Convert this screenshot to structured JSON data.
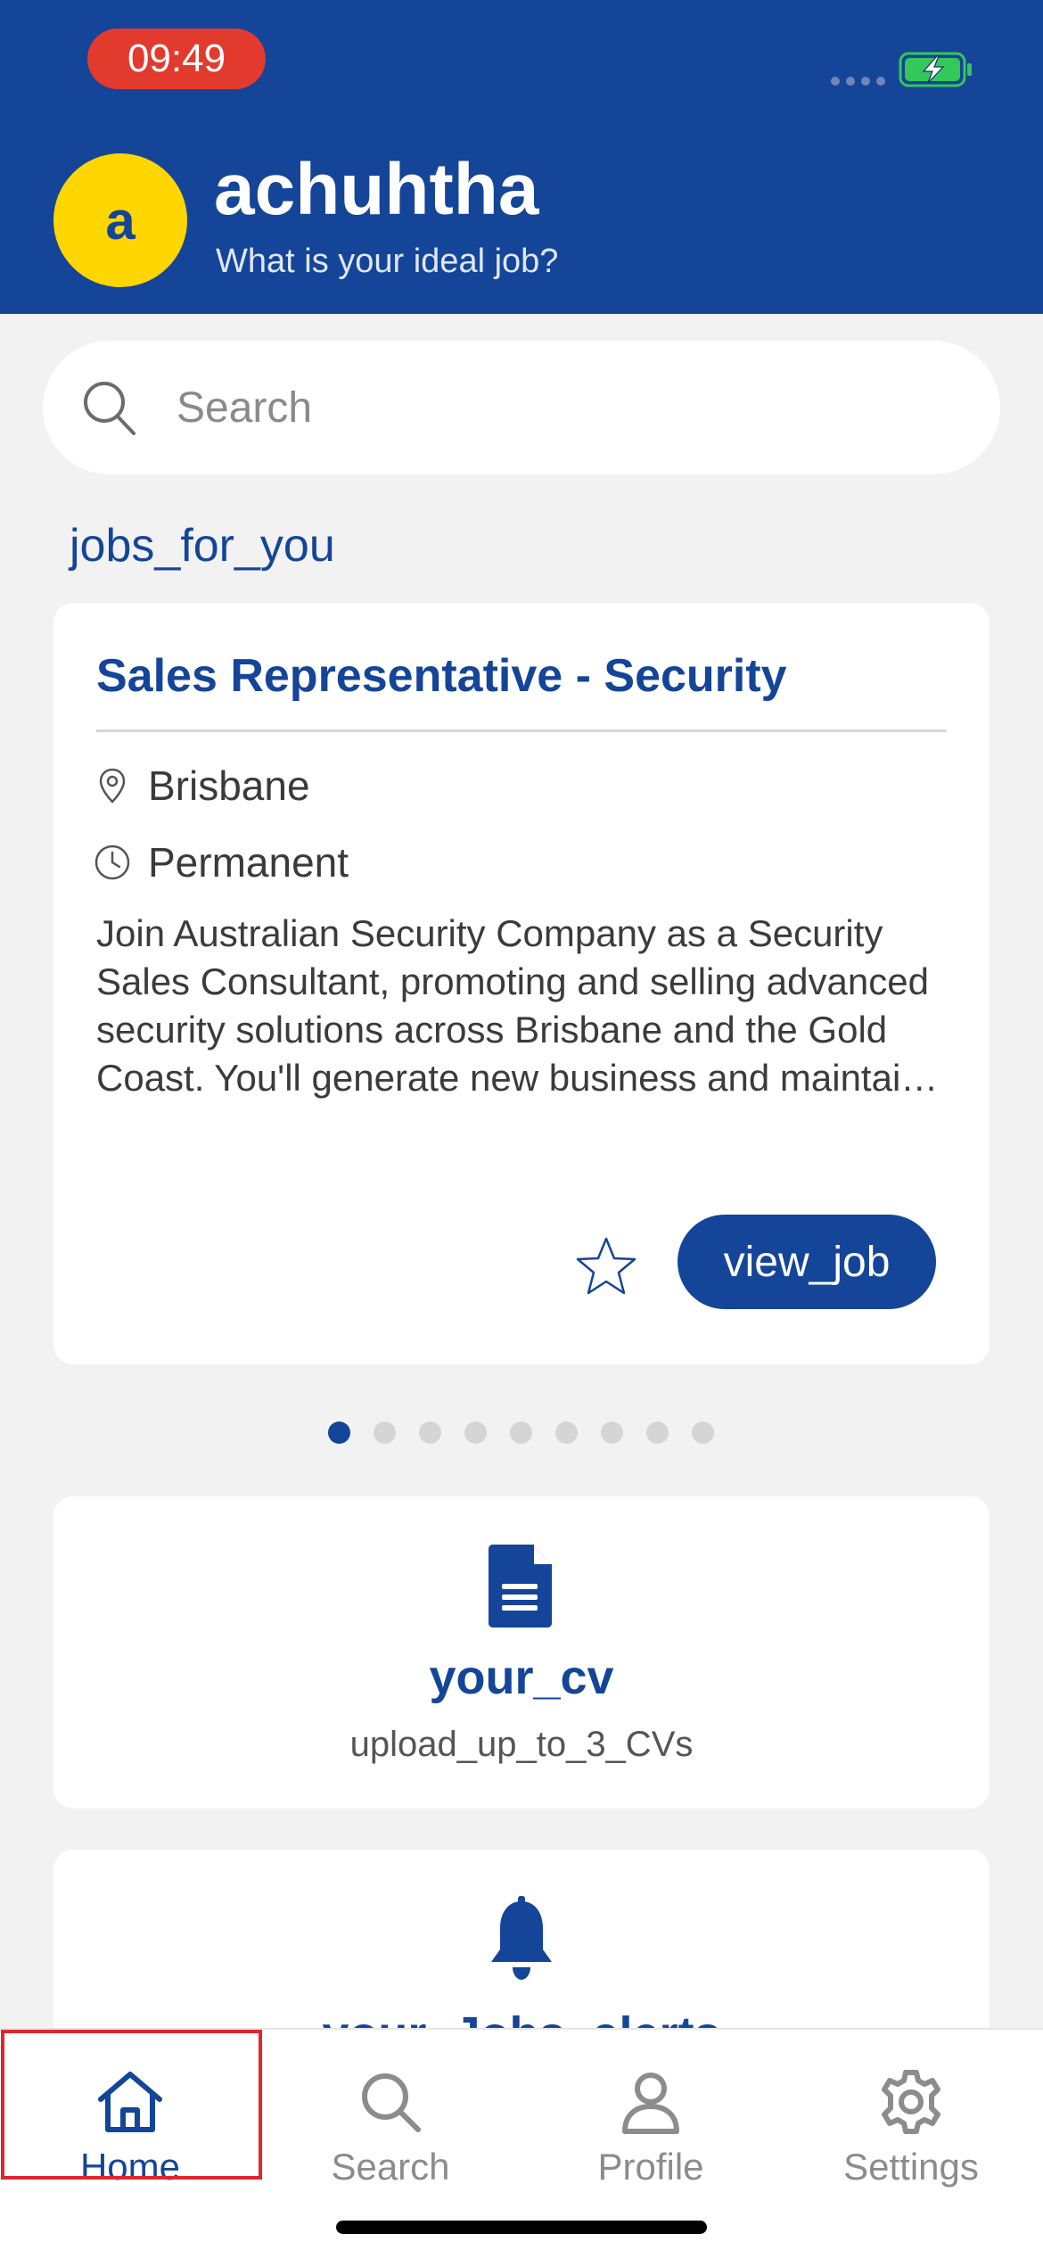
{
  "status_bar": {
    "time": "09:49"
  },
  "header": {
    "avatar_letter": "a",
    "username": "achuhtha",
    "tagline": "What is your ideal job?"
  },
  "search": {
    "placeholder": "Search",
    "value": ""
  },
  "jobs_section": {
    "title": "jobs_for_you"
  },
  "job_card": {
    "title": "Sales Representative - Security",
    "location": "Brisbane",
    "type": "Permanent",
    "description": "Join Australian Security Company as a Security Sales Consultant, promoting and selling advanced security solutions across Brisbane and the Gold Coast. You'll generate new business and maintain strong relationships with clients.",
    "view_button": "view_job",
    "page_count": 9,
    "active_page": 1
  },
  "cv_card": {
    "title": "your_cv",
    "subtitle": "upload_up_to_3_CVs"
  },
  "alerts_card": {
    "title": "your_Jobs_alerts"
  },
  "tab_bar": {
    "home": "Home",
    "search": "Search",
    "profile": "Profile",
    "settings": "Settings",
    "active_tab": "Home"
  },
  "colors": {
    "brand_blue": "#144598",
    "avatar_yellow": "#ffd600",
    "time_pill_red": "#e23b2e",
    "battery_green": "#34c759",
    "highlight_red": "#e0262c"
  }
}
